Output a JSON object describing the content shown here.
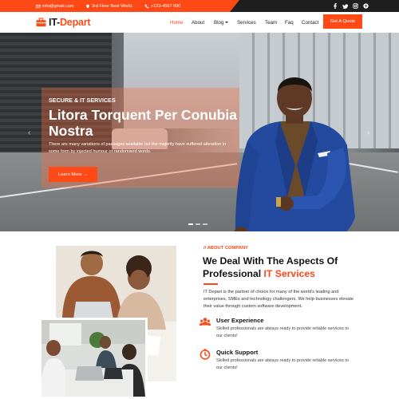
{
  "topbar": {
    "email": "info@gmail.com",
    "address": "3rd Floor Best World.",
    "phone": "+123-4567 890",
    "social": [
      "facebook-icon",
      "twitter-icon",
      "instagram-icon",
      "pinterest-icon"
    ]
  },
  "brand": {
    "name_part1": "IT-",
    "name_part2": "Depart"
  },
  "nav": {
    "items": [
      "Home",
      "About",
      "Blog",
      "Services",
      "Team",
      "Faq",
      "Contact"
    ],
    "active": "Home",
    "cta": "Get A Quote"
  },
  "hero": {
    "tag": "SECURE & IT SERVICES",
    "title": "Litora Torquent Per Conubia Nostra",
    "description": "There are many variations of passages available but the majority have suffered alteration in some form by injected humour or randomised words.",
    "button": "Learn More →",
    "prev": "‹",
    "next": "›"
  },
  "about": {
    "tag": "// ABOUT COMPANY",
    "title_part1": "We Deal With The Aspects Of Professional ",
    "title_accent": "IT Services",
    "description": "IT Depart is the partner of choice for many of the world's leading and enterprises, SMEs and technology challengers. We help businesses elevate their value through custom software development.",
    "features": [
      {
        "icon": "users-icon",
        "title": "User Experience",
        "desc": "Skilled professionals are always ready to provide reliable services to our clients!"
      },
      {
        "icon": "clock-icon",
        "title": "Quick Support",
        "desc": "Skilled professionals are always ready to provide reliable services to our clients!"
      }
    ]
  },
  "colors": {
    "accent": "#ff4a17",
    "dark": "#1f1f1f"
  }
}
